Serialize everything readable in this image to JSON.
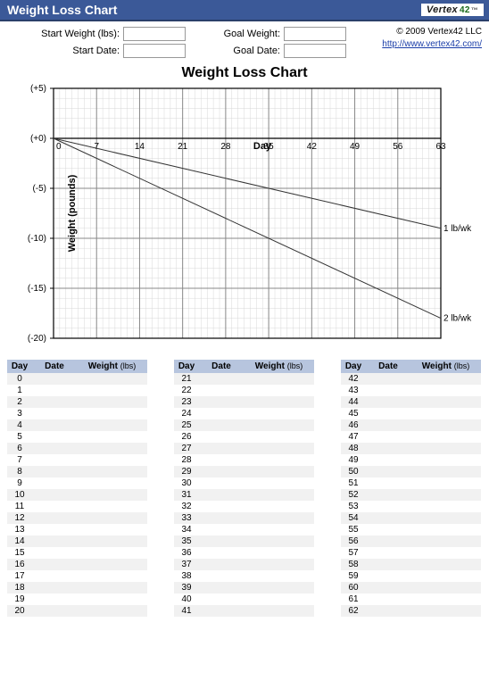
{
  "titlebar": {
    "title": "Weight Loss Chart",
    "brand_name": "Vertex",
    "brand_suffix": "42",
    "tm": "™"
  },
  "header": {
    "start_weight_label": "Start Weight (lbs):",
    "start_date_label": "Start Date:",
    "goal_weight_label": "Goal Weight:",
    "goal_date_label": "Goal Date:",
    "start_weight_value": "",
    "start_date_value": "",
    "goal_weight_value": "",
    "goal_date_value": "",
    "copyright": "© 2009 Vertex42 LLC",
    "link_text": "http://www.vertex42.com/"
  },
  "chart_data": {
    "type": "line",
    "title": "Weight Loss Chart",
    "xlabel": "Day",
    "ylabel": "Weight (pounds)",
    "xlim": [
      0,
      63
    ],
    "ylim": [
      -20,
      5
    ],
    "x_ticks": [
      0,
      7,
      14,
      21,
      28,
      35,
      42,
      49,
      56,
      63
    ],
    "y_ticks_labels": [
      "(+5)",
      "(+0)",
      "(-5)",
      "(-10)",
      "(-15)",
      "(-20)"
    ],
    "y_ticks_values": [
      5,
      0,
      -5,
      -10,
      -15,
      -20
    ],
    "series": [
      {
        "name": "1 lb/wk",
        "x": [
          0,
          63
        ],
        "y": [
          0,
          -9
        ]
      },
      {
        "name": "2 lb/wk",
        "x": [
          0,
          63
        ],
        "y": [
          0,
          -18
        ]
      }
    ]
  },
  "tables": {
    "header_day": "Day",
    "header_date": "Date",
    "header_weight": "Weight",
    "header_weight_unit": "(lbs)",
    "col1_days": [
      0,
      1,
      2,
      3,
      4,
      5,
      6,
      7,
      8,
      9,
      10,
      11,
      12,
      13,
      14,
      15,
      16,
      17,
      18,
      19,
      20
    ],
    "col2_days": [
      21,
      22,
      23,
      24,
      25,
      26,
      27,
      28,
      29,
      30,
      31,
      32,
      33,
      34,
      35,
      36,
      37,
      38,
      39,
      40,
      41
    ],
    "col3_days": [
      42,
      43,
      44,
      45,
      46,
      47,
      48,
      49,
      50,
      51,
      52,
      53,
      54,
      55,
      56,
      57,
      58,
      59,
      60,
      61,
      62
    ]
  }
}
